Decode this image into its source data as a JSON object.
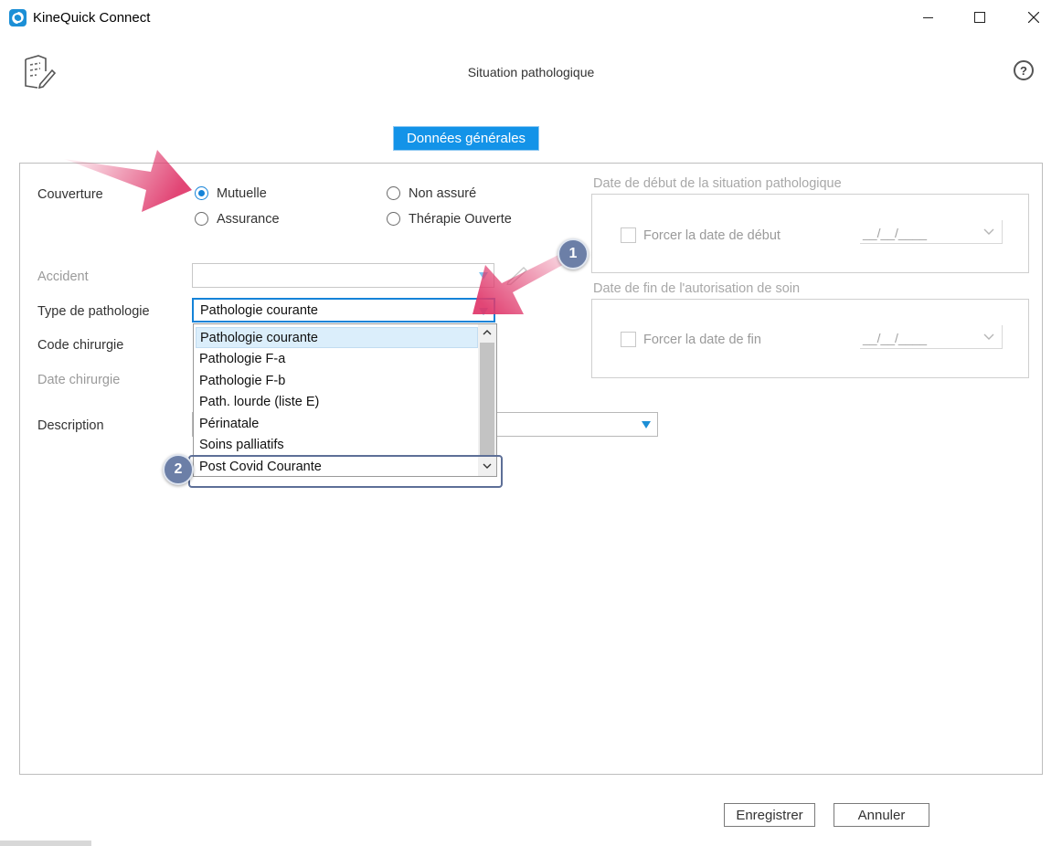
{
  "window": {
    "title": "KineQuick Connect",
    "controls": [
      "minimize-icon",
      "maximize-icon",
      "close-icon"
    ]
  },
  "header": {
    "title": "Situation pathologique",
    "help_label": "?"
  },
  "tabs": [
    {
      "label": "Données générales",
      "active": true
    }
  ],
  "form": {
    "couverture": {
      "label": "Couverture",
      "options": [
        {
          "label": "Mutuelle",
          "checked": true
        },
        {
          "label": "Non assuré",
          "checked": false
        },
        {
          "label": "Assurance",
          "checked": false
        },
        {
          "label": "Thérapie Ouverte",
          "checked": false
        }
      ]
    },
    "accident": {
      "label": "Accident",
      "value": ""
    },
    "type_pathologie": {
      "label": "Type de pathologie",
      "value": "Pathologie courante",
      "options": [
        "Pathologie courante",
        "Pathologie F-a",
        "Pathologie F-b",
        "Path. lourde (liste E)",
        "Périnatale",
        "Soins palliatifs",
        "Post Covid Courante"
      ]
    },
    "code_chirurgie": {
      "label": "Code chirurgie"
    },
    "date_chirurgie": {
      "label": "Date chirurgie"
    },
    "description": {
      "label": "Description",
      "value": ""
    },
    "date_debut": {
      "group_title": "Date de début de la situation pathologique",
      "checkbox_label": "Forcer la date de début",
      "value": "__/__/____"
    },
    "date_fin": {
      "group_title": "Date de fin de l'autorisation de soin",
      "checkbox_label": "Forcer la date de fin",
      "value": "__/__/____"
    }
  },
  "annotations": {
    "badge1": "1",
    "badge2": "2"
  },
  "footer": {
    "save_label": "Enregistrer",
    "cancel_label": "Annuler"
  },
  "colors": {
    "accent": "#1393e8",
    "arrow": "#e03c6e",
    "badge": "#6c7fa7"
  }
}
